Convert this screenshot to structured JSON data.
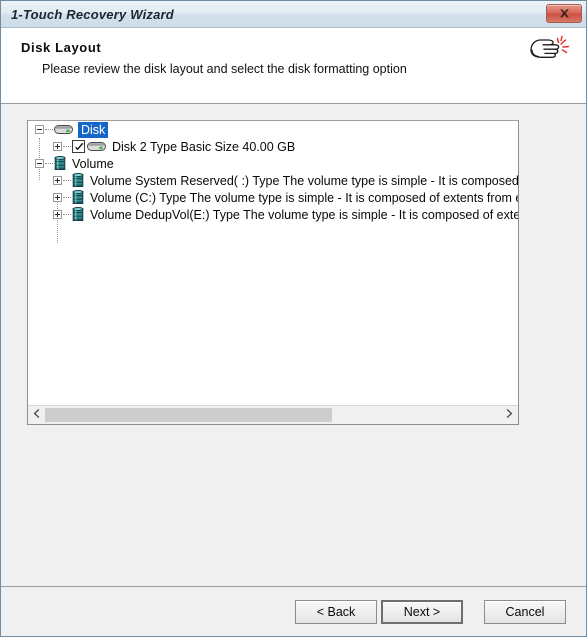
{
  "window": {
    "title": "1-Touch Recovery Wizard",
    "close_icon": "close-x-icon"
  },
  "header": {
    "title": "Disk Layout",
    "subtitle": "Please review the disk layout and select the disk formatting option",
    "icon": "pointing-hand-click-icon"
  },
  "treeview": {
    "nodes": [
      {
        "label": "Disk",
        "level": 0,
        "expander": "minus",
        "icon": "disk-drive-icon",
        "selected": true,
        "checkbox": null
      },
      {
        "label": "Disk 2 Type Basic Size 40.00 GB",
        "level": 1,
        "expander": "plus",
        "icon": "disk-drive-icon",
        "selected": false,
        "checkbox": "checked"
      },
      {
        "label": "Volume",
        "level": 0,
        "expander": "minus",
        "icon": "volume-drum-icon",
        "selected": false,
        "checkbox": null
      },
      {
        "label": "Volume System Reserved( :) Type The volume type is simple - It is composed of exte",
        "level": 1,
        "expander": "plus",
        "icon": "volume-drum-icon",
        "selected": false,
        "checkbox": null
      },
      {
        "label": "Volume (C:) Type The volume type is simple - It is composed of extents from exactly",
        "level": 1,
        "expander": "plus",
        "icon": "volume-drum-icon",
        "selected": false,
        "checkbox": null
      },
      {
        "label": "Volume DedupVol(E:) Type The volume type is simple - It is composed of extents fro",
        "level": 1,
        "expander": "plus",
        "icon": "volume-drum-icon",
        "selected": false,
        "checkbox": null
      }
    ],
    "scrollbar": {
      "left_arrow_icon": "chevron-left-icon",
      "right_arrow_icon": "chevron-right-icon",
      "thumb_fraction": "63%"
    }
  },
  "footer": {
    "back_label": "< Back",
    "next_label": "Next >",
    "cancel_label": "Cancel"
  },
  "colors": {
    "selection_blue": "#1668c8",
    "titlebar_top": "#eef3f8",
    "titlebar_bottom": "#cfdde9",
    "close_red": "#c9513f",
    "volume_icon_teal": "#2f8f93",
    "disk_led_green": "#56b14a",
    "body_grey": "#f0f0f0"
  }
}
